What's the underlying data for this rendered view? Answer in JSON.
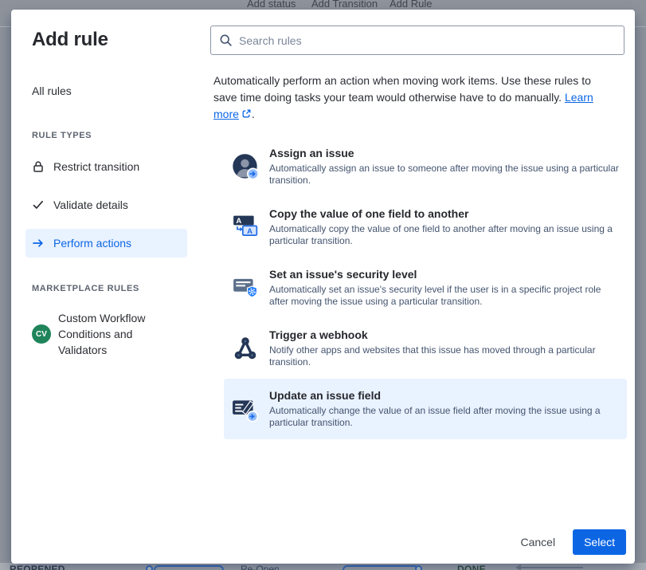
{
  "colors": {
    "accent_blue": "#0c66e4",
    "selected_bg": "#e9f2ff",
    "marketplace_green": "#1f845a",
    "icon_navy": "#243757",
    "overlay_gray": "#8e939b"
  },
  "background": {
    "toolbar_items": [
      "Add status",
      "Add Transition",
      "Add Rule"
    ],
    "workflow": {
      "left_status": "REOPENED",
      "transition_label": "Re-Open",
      "right_status": "DONE"
    }
  },
  "modal": {
    "title": "Add rule",
    "search_placeholder": "Search rules",
    "sidebar": {
      "all_rules_label": "All rules",
      "rule_types_heading": "RULE TYPES",
      "rule_types": [
        {
          "label": "Restrict transition"
        },
        {
          "label": "Validate details"
        },
        {
          "label": "Perform actions"
        }
      ],
      "marketplace_heading": "MARKETPLACE RULES",
      "marketplace_item": {
        "badge": "CV",
        "label": "Custom Workflow Conditions and Validators"
      }
    },
    "intro": {
      "text": "Automatically perform an action when moving work items. Use these rules to save time doing tasks your team would otherwise have to do manually.",
      "link_label": "Learn more",
      "suffix": "."
    },
    "rules": [
      {
        "title": "Assign an issue",
        "description": "Automatically assign an issue to someone after moving the issue using a particular transition."
      },
      {
        "title": "Copy the value of one field to another",
        "description": "Automatically copy the value of one field to another after moving an issue using a particular transition."
      },
      {
        "title": "Set an issue's security level",
        "description": "Automatically set an issue's security level if the user is in a specific project role after moving the issue using a particular transition."
      },
      {
        "title": "Trigger a webhook",
        "description": "Notify other apps and websites that this issue has moved through a particular transition."
      },
      {
        "title": "Update an issue field",
        "description": "Automatically change the value of an issue field after moving the issue using a particular transition."
      }
    ],
    "footer": {
      "cancel_label": "Cancel",
      "select_label": "Select"
    }
  }
}
